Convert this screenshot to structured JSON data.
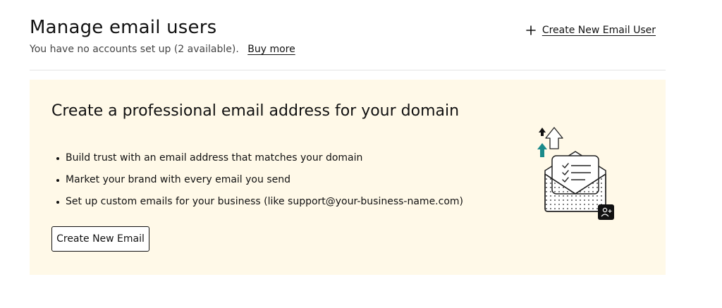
{
  "header": {
    "title": "Manage email users",
    "subtitle": "You have no accounts set up (2 available).",
    "buy_more": "Buy more",
    "create_user": "Create New Email User"
  },
  "promo": {
    "title": "Create a professional email address for your domain",
    "benefits": [
      "Build trust with an email address that matches your domain",
      "Market your brand with every email you send",
      "Set up custom emails for your business (like support@your-business-name.com)"
    ],
    "button": "Create New Email"
  },
  "icons": {
    "plus": "plus-icon",
    "illustration": "email-envelope-illustration",
    "badge": "add-user-icon"
  },
  "colors": {
    "promo_background": "#fff9e8",
    "accent_arrow": "#1a8a8a",
    "text": "#111111"
  }
}
